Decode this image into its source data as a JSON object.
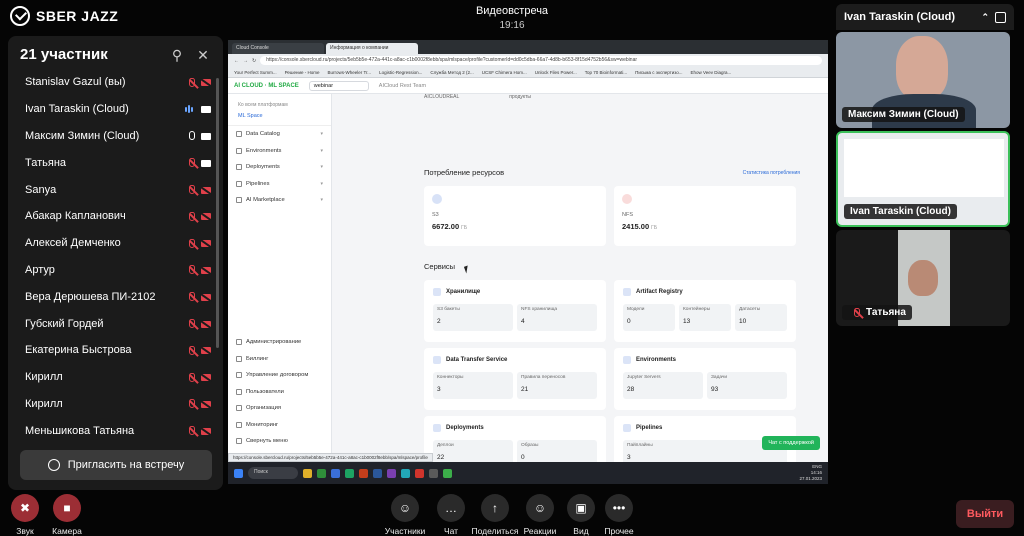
{
  "app": {
    "logo_text": "SBER JAZZ"
  },
  "call": {
    "title": "Видеовстреча",
    "time": "19:16"
  },
  "participants_panel": {
    "title": "21 участник",
    "invite_label": "Пригласить на встречу",
    "participants": [
      {
        "name": "Stanislav Gazul (вы)",
        "mic": "off",
        "cam": "off"
      },
      {
        "name": "Ivan Taraskin (Cloud)",
        "mic": "speaking",
        "cam": "on"
      },
      {
        "name": "Максим Зимин (Cloud)",
        "mic": "on",
        "cam": "on"
      },
      {
        "name": "Татьяна",
        "mic": "off",
        "cam": "on"
      },
      {
        "name": "Sanya",
        "mic": "off",
        "cam": "off"
      },
      {
        "name": "Абакар Капланович",
        "mic": "off",
        "cam": "off"
      },
      {
        "name": "Алексей Демченко",
        "mic": "off",
        "cam": "off"
      },
      {
        "name": "Артур",
        "mic": "off",
        "cam": "off"
      },
      {
        "name": "Вера Дерюшева ПИ-2102",
        "mic": "off",
        "cam": "off"
      },
      {
        "name": "Губский Гордей",
        "mic": "off",
        "cam": "off"
      },
      {
        "name": "Екатерина Быстрова",
        "mic": "off",
        "cam": "off"
      },
      {
        "name": "Кирилл",
        "mic": "off",
        "cam": "off"
      },
      {
        "name": "Кирилл",
        "mic": "off",
        "cam": "off"
      },
      {
        "name": "Меньшикова Татьяна",
        "mic": "off",
        "cam": "off"
      }
    ]
  },
  "shared_screen": {
    "browser": {
      "tabs": [
        "Cloud Console",
        "Информация о компании"
      ],
      "url": "https://console.sbercloud.ru/projects/5eb5b5e-472a-441c-a8ac-c1b0002f8ebb/spa/mlspace/profile?customerId=dd0c5dba-66a7-4d8b-b653-8f15d4752b56&sw=webinar",
      "bookmarks": [
        "Your Perfect Summ...",
        "Решение - Home",
        "Burrows-Wheeler Tr...",
        "Logistic-Regression...",
        "Служба Метод 2 (2...",
        "UCSF Chimera Hom...",
        "Unlock Files Power...",
        "Top 70 Bioinformati...",
        "Письма с экспертизо...",
        "Ehow Veev Diagra..."
      ],
      "status_url": "https://console.sbercloud.ru/projects/5eb5b5e-472a-441c-a8ac-c1b0002f8ebb/spa/mlspace/profile"
    },
    "site": {
      "logo": "AI CLOUD · ML SPACE",
      "workspace_select": "webinar",
      "project": "AICloud Rest Team",
      "back_link": "Ко всем платформам",
      "section_label": "ML Space",
      "nav": [
        "Data Catalog",
        "Environments",
        "Deployments",
        "Pipelines",
        "AI Marketplace"
      ],
      "bottom_nav": [
        "Администрирование",
        "Биллинг",
        "Управление договором",
        "Пользователи",
        "Организация",
        "Мониторинг",
        "Свернуть меню"
      ],
      "crumbs": [
        "AICLOUDREAL",
        "продукты"
      ],
      "resources_title": "Потребление ресурсов",
      "stats_link": "Статистика потребления",
      "resources": [
        {
          "label": "S3",
          "value": "6672.00",
          "unit": "ГБ",
          "color": "#3a6fd8"
        },
        {
          "label": "NFS",
          "value": "2415.00",
          "unit": "ГБ",
          "color": "#e0504a"
        }
      ],
      "services_title": "Сервисы",
      "services": [
        {
          "name": "Хранилище",
          "metrics": [
            {
              "label": "S3 бакеты",
              "value": "2"
            },
            {
              "label": "NFS хранилища",
              "value": "4"
            }
          ]
        },
        {
          "name": "Artifact Registry",
          "metrics": [
            {
              "label": "Модели",
              "value": "0"
            },
            {
              "label": "Контейнеры",
              "value": "13"
            },
            {
              "label": "Датасеты",
              "value": "10"
            }
          ]
        },
        {
          "name": "Data Transfer Service",
          "metrics": [
            {
              "label": "Коннекторы",
              "value": "3"
            },
            {
              "label": "Правила переносов",
              "value": "21"
            }
          ]
        },
        {
          "name": "Environments",
          "metrics": [
            {
              "label": "Jupyter Servers",
              "value": "28"
            },
            {
              "label": "Задачи",
              "value": "93"
            }
          ]
        },
        {
          "name": "Deployments",
          "metrics": [
            {
              "label": "Деплои",
              "value": "22"
            },
            {
              "label": "Образы",
              "value": "0"
            }
          ]
        },
        {
          "name": "Pipelines",
          "metrics": [
            {
              "label": "Пайплайны",
              "value": "3"
            }
          ]
        }
      ],
      "chat_support": "Чат с поддержкой"
    },
    "taskbar": {
      "search": "Поиск",
      "lang": "ENG",
      "time": "14:16",
      "date": "27.01.2023"
    }
  },
  "videos": {
    "header_name": "Ivan Taraskin (Cloud)",
    "tiles": [
      {
        "name": "Максим Зимин (Cloud)"
      },
      {
        "name": "Ivan Taraskin (Cloud)"
      },
      {
        "name": "Татьяна"
      }
    ]
  },
  "controls": [
    {
      "label": "Звук",
      "icon": "mic-off-icon"
    },
    {
      "label": "Камера",
      "icon": "camera-off-icon"
    },
    {
      "label": "Участники",
      "icon": "people-icon"
    },
    {
      "label": "Чат",
      "icon": "chat-icon"
    },
    {
      "label": "Поделиться",
      "icon": "share-screen-icon"
    },
    {
      "label": "Реакции",
      "icon": "smile-icon"
    },
    {
      "label": "Вид",
      "icon": "layout-icon"
    },
    {
      "label": "Прочее",
      "icon": "more-icon"
    }
  ],
  "exit_label": "Выйти"
}
